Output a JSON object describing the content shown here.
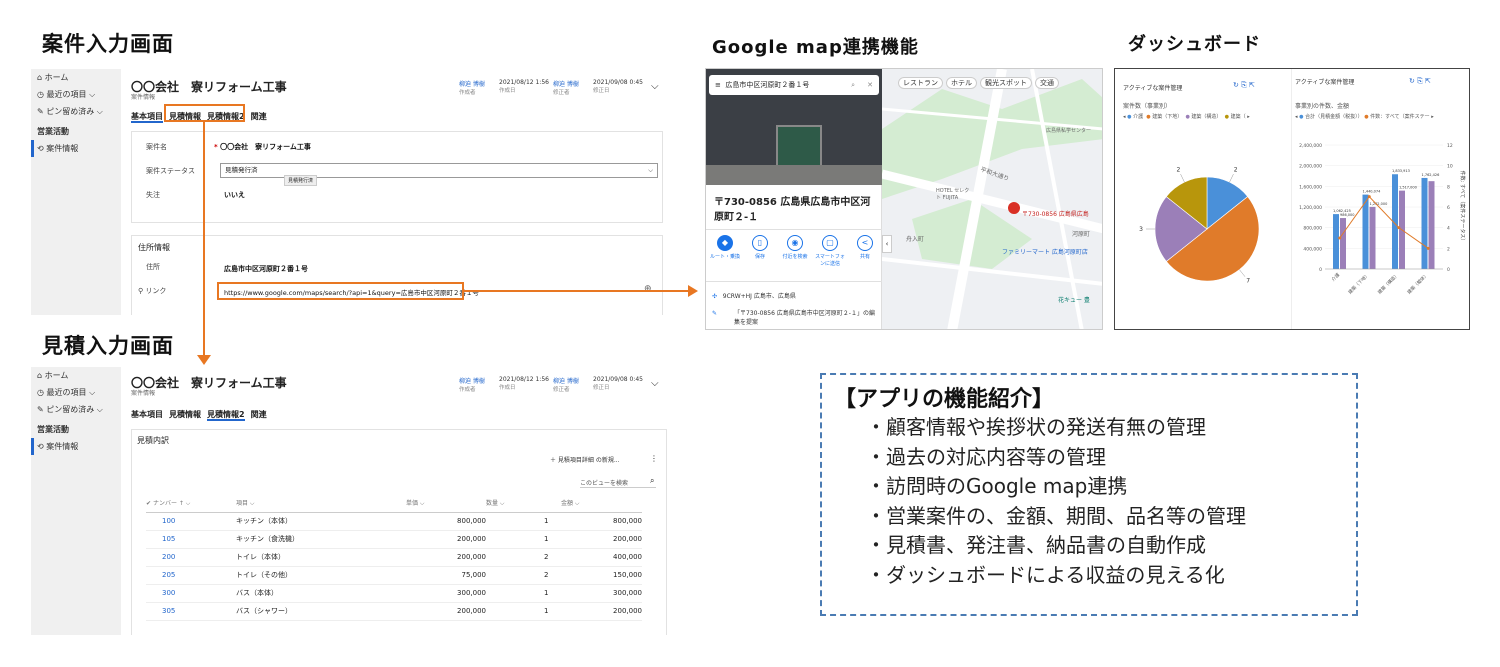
{
  "titles": {
    "case_screen": "案件入力画面",
    "estimate_screen": "見積入力画面",
    "map": "Google map連携機能",
    "dashboard": "ダッシュボード"
  },
  "nav": {
    "home": "ホーム",
    "recent": "最近の項目",
    "pinned": "ピン留め済み",
    "section": "営業活動",
    "case_info": "案件情報"
  },
  "record": {
    "title": "〇〇会社　寮リフォーム工事",
    "entity": "案件情報",
    "creator_name": "柳迫 博樹",
    "creator_label": "作成者",
    "created_on": "2021/08/12 1:56",
    "created_label": "作成日",
    "modifier_name": "柳迫 博樹",
    "modifier_label": "修正者",
    "modified_on": "2021/09/08 0:45",
    "modified_label": "修正日"
  },
  "tabs": {
    "basic": "基本項目",
    "estimate": "見積情報",
    "estimate2": "見積情報2",
    "related": "関連"
  },
  "case_form": {
    "name_label": "案件名",
    "name_value": "〇〇会社　寮リフォーム工事",
    "status_label": "案件ステータス",
    "status_value": "見積発行済",
    "status_tooltip": "見積発行済",
    "lost_label": "失注",
    "lost_value": "いいえ",
    "address_section": "住所情報",
    "address_label": "住所",
    "address_value": "広島市中区河原町２番１号",
    "link_label": "リンク",
    "link_value": "https://www.google.com/maps/search/?api=1&query=広島市中区河原町２番１号"
  },
  "estimate": {
    "section": "見積内訳",
    "new_button": "見積項目詳細 の新規...",
    "search_placeholder": "このビューを検索",
    "columns": [
      "ナンバー ↑",
      "項目",
      "単価",
      "数量",
      "金額"
    ],
    "rows": [
      [
        "100",
        "キッチン（本体）",
        "800,000",
        "1",
        "800,000"
      ],
      [
        "105",
        "キッチン（食洗機）",
        "200,000",
        "1",
        "200,000"
      ],
      [
        "200",
        "トイレ（本体）",
        "200,000",
        "2",
        "400,000"
      ],
      [
        "205",
        "トイレ（その他）",
        "75,000",
        "2",
        "150,000"
      ],
      [
        "300",
        "バス（本体）",
        "300,000",
        "1",
        "300,000"
      ],
      [
        "305",
        "バス（シャワー）",
        "200,000",
        "1",
        "200,000"
      ]
    ]
  },
  "map": {
    "search_text": "広島市中区河原町２番１号",
    "filters": [
      "レストラン",
      "ホテル",
      "観光スポット",
      "交通"
    ],
    "place_title": "〒730-0856 広島県広島市中区河原町２-１",
    "actions": [
      "ルート・乗換",
      "保存",
      "付近を検索",
      "スマートフォンに送信",
      "共有"
    ],
    "plus_code": "9CRW+HJ 広島市、広島県",
    "suggest_edit": "「〒730-0856 広島県広島市中区河原町２-１」の編集を提案",
    "pin_label": "〒730-0856 広島県広島",
    "labels": [
      "平和大通り",
      "HOTEL セレクト FUJITA",
      "河原町",
      "ファミリーマート 広島河原町店",
      "花キュー 豊",
      "広島県私学センター",
      "舟入町"
    ]
  },
  "colors": {
    "orange": "#e87722",
    "blue": "#2266cc",
    "dash": "#4a7bb3"
  },
  "chart_data": [
    {
      "type": "pie",
      "title": "アクティブな案件管理",
      "subtitle": "案件数（事業別）",
      "legend": [
        "介護",
        "建築（下地）",
        "建築（構造）",
        "建築（"
      ],
      "values": [
        2,
        7,
        3,
        2
      ],
      "colors": [
        "#4a90d9",
        "#e07b2a",
        "#9b7fb8",
        "#b8960c"
      ]
    },
    {
      "type": "bar",
      "title": "アクティブな案件管理",
      "subtitle": "事業別の件数、金額",
      "legend": [
        "合計（見積金額（税抜））",
        "件数：すべて（案件ステー"
      ],
      "categories": [
        "介護",
        "建築（下地）",
        "建築（構造）",
        "建築（躯体）"
      ],
      "series": [
        {
          "name": "合計（見積金額（税抜））",
          "values": [
            1062425,
            1440074,
            1833913,
            1762426
          ]
        },
        {
          "name": "件数：すべて（案件ステー",
          "values": [
            986000,
            1202000,
            1517000,
            1700000
          ]
        }
      ],
      "line_values": [
        3,
        7,
        4,
        2
      ],
      "data_labels": [
        "1,062,425",
        "1,440,074",
        "1,833,913",
        "1,762,426",
        "986,000",
        "1,202,000",
        "1,517,000"
      ],
      "ylim": [
        0,
        2400000
      ],
      "y_ticks": [
        "2,400,000",
        "2,000,000",
        "1,600,000",
        "1,200,000",
        "800,000",
        "400,000",
        "0"
      ],
      "y2_ticks": [
        "12",
        "10",
        "8",
        "6",
        "4",
        "2",
        "0"
      ],
      "ylabel2": "件数: すべて（案件ステータス）"
    }
  ],
  "features": {
    "title": "【アプリの機能紹介】",
    "items": [
      "・顧客情報や挨拶状の発送有無の管理",
      "・過去の対応内容等の管理",
      "・訪問時のGoogle map連携",
      "・営業案件の、金額、期間、品名等の管理",
      "・見積書、発注書、納品書の自動作成",
      "・ダッシュボードによる収益の見える化"
    ]
  }
}
